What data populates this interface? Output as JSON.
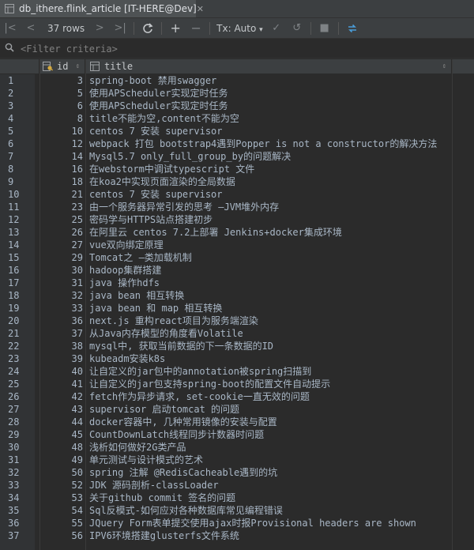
{
  "tab": {
    "title": "db_ithere.flink_article [IT-HERE@Dev]",
    "close_glyph": "✕"
  },
  "toolbar": {
    "rows_label": "37 rows",
    "tx_label": "Tx: Auto",
    "icons": [
      "first-page-icon",
      "prev-page-icon",
      "next-page-icon",
      "last-page-icon",
      "refresh-icon",
      "add-row-icon",
      "delete-row-icon",
      "commit-icon",
      "rollback-icon",
      "stop-icon",
      "compare-icon"
    ]
  },
  "filter": {
    "placeholder": "<Filter criteria>"
  },
  "columns": {
    "id": "id",
    "title": "title"
  },
  "rows": [
    {
      "n": "1",
      "id": "3",
      "title": "spring-boot 禁用swagger"
    },
    {
      "n": "2",
      "id": "5",
      "title": "使用APScheduler实现定时任务"
    },
    {
      "n": "3",
      "id": "6",
      "title": "使用APScheduler实现定时任务"
    },
    {
      "n": "4",
      "id": "8",
      "title": "title不能为空,content不能为空"
    },
    {
      "n": "5",
      "id": "10",
      "title": "centos 7 安装 supervisor"
    },
    {
      "n": "6",
      "id": "12",
      "title": "webpack 打包 bootstrap4遇到Popper is not a constructor的解决方法"
    },
    {
      "n": "7",
      "id": "14",
      "title": "Mysql5.7 only_full_group_by的问题解决"
    },
    {
      "n": "8",
      "id": "16",
      "title": "在webstorm中调试typescript 文件"
    },
    {
      "n": "9",
      "id": "18",
      "title": "在koa2中实现页面渲染的全局数据"
    },
    {
      "n": "10",
      "id": "21",
      "title": "centos 7 安装 supervisor"
    },
    {
      "n": "11",
      "id": "23",
      "title": "由一个服务器异常引发的思考 —JVM堆外内存"
    },
    {
      "n": "12",
      "id": "25",
      "title": "密码学与HTTPS站点搭建初步"
    },
    {
      "n": "13",
      "id": "26",
      "title": "在阿里云 centos 7.2上部署 Jenkins+docker集成环境"
    },
    {
      "n": "14",
      "id": "27",
      "title": "vue双向绑定原理"
    },
    {
      "n": "15",
      "id": "29",
      "title": "Tomcat之 —类加载机制"
    },
    {
      "n": "16",
      "id": "30",
      "title": "hadoop集群搭建"
    },
    {
      "n": "17",
      "id": "31",
      "title": "java 操作hdfs"
    },
    {
      "n": "18",
      "id": "32",
      "title": "java bean 相互转换"
    },
    {
      "n": "19",
      "id": "33",
      "title": "java bean 和 map 相互转换"
    },
    {
      "n": "20",
      "id": "36",
      "title": "next.js 重构react项目为服务端渲染"
    },
    {
      "n": "21",
      "id": "37",
      "title": "从Java内存模型的角度看Volatile"
    },
    {
      "n": "22",
      "id": "38",
      "title": "mysql中, 获取当前数据的下一条数据的ID"
    },
    {
      "n": "23",
      "id": "39",
      "title": "kubeadm安装k8s"
    },
    {
      "n": "24",
      "id": "40",
      "title": "让自定义的jar包中的annotation被spring扫描到"
    },
    {
      "n": "25",
      "id": "41",
      "title": "让自定义的jar包支持spring-boot的配置文件自动提示"
    },
    {
      "n": "26",
      "id": "42",
      "title": "fetch作为异步请求, set-cookie一直无效的问题"
    },
    {
      "n": "27",
      "id": "43",
      "title": "supervisor 启动tomcat 的问题"
    },
    {
      "n": "28",
      "id": "44",
      "title": "docker容器中, 几种常用镜像的安装与配置"
    },
    {
      "n": "29",
      "id": "45",
      "title": "CountDownLatch线程同步计数器时问题"
    },
    {
      "n": "30",
      "id": "48",
      "title": "浅析如何做好2G类产品"
    },
    {
      "n": "31",
      "id": "49",
      "title": "单元测试与设计模式的艺术"
    },
    {
      "n": "32",
      "id": "50",
      "title": "spring 注解 @RedisCacheable遇到的坑"
    },
    {
      "n": "33",
      "id": "52",
      "title": "JDK 源码剖析-classLoader"
    },
    {
      "n": "34",
      "id": "53",
      "title": "关于github commit 签名的问题"
    },
    {
      "n": "35",
      "id": "54",
      "title": "Sql反模式-如何应对各种数据库常见编程错误"
    },
    {
      "n": "36",
      "id": "55",
      "title": "JQuery Form表单提交使用ajax时报Provisional headers are shown"
    },
    {
      "n": "37",
      "id": "56",
      "title": "IPV6环境搭建glusterfs文件系统"
    }
  ]
}
